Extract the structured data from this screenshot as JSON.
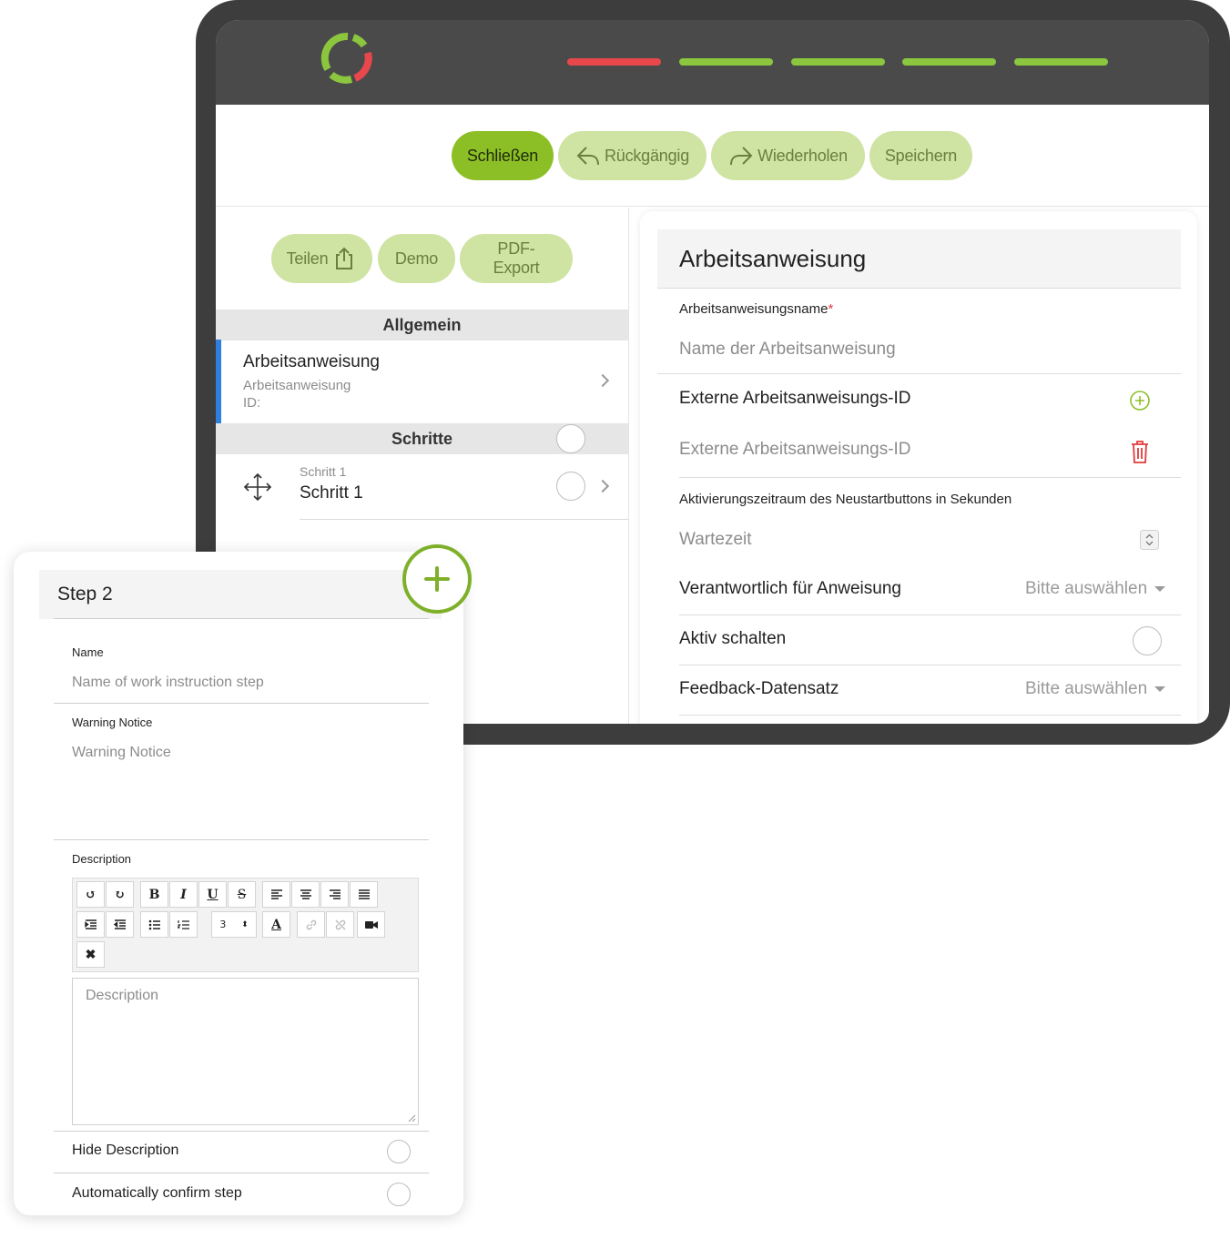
{
  "toolbar": {
    "close_label": "Schließen",
    "undo_label": "Rückgängig",
    "redo_label": "Wiederholen",
    "save_label": "Speichern"
  },
  "subtoolbar": {
    "share_label": "Teilen",
    "demo_label": "Demo",
    "pdf_label": "PDF-Export"
  },
  "sections": {
    "general": "Allgemein",
    "steps": "Schritte"
  },
  "instruction_item": {
    "title": "Arbeitsanweisung",
    "subtitle": "Arbeitsanweisung",
    "id_label": "ID:"
  },
  "step_item": {
    "small": "Schritt 1",
    "title": "Schritt 1"
  },
  "form": {
    "title": "Arbeitsanweisung",
    "name_label": "Arbeitsanweisungsname",
    "required_mark": "*",
    "name_placeholder": "Name der Arbeitsanweisung",
    "external_id_label": "Externe Arbeitsanweisungs-ID",
    "external_id_placeholder": "Externe Arbeitsanweisungs-ID",
    "restart_label": "Aktivierungszeitraum des Neustartbuttons in Sekunden",
    "wait_placeholder": "Wartezeit",
    "responsible_label": "Verantwortlich für Anweisung",
    "responsible_value": "Bitte auswählen",
    "active_label": "Aktiv schalten",
    "feedback_label": "Feedback-Datensatz",
    "feedback_value": "Bitte auswählen"
  },
  "progress_colors": [
    "#e8474c",
    "#8cc63f",
    "#8cc63f",
    "#8cc63f",
    "#8cc63f"
  ],
  "step_card": {
    "title": "Step 2",
    "name_label": "Name",
    "name_placeholder": "Name of work instruction step",
    "warning_label": "Warning Notice",
    "warning_placeholder": "Warning Notice",
    "description_label": "Description",
    "description_placeholder": "Description",
    "font_size": "3",
    "hide_description_label": "Hide Description",
    "auto_confirm_label": "Automatically confirm step"
  },
  "editor_buttons": {
    "bold": "B",
    "italic": "I",
    "underline": "U",
    "strike": "S",
    "color": "A"
  },
  "accent_color": "#8cbf26",
  "danger_color": "#e23b3b"
}
